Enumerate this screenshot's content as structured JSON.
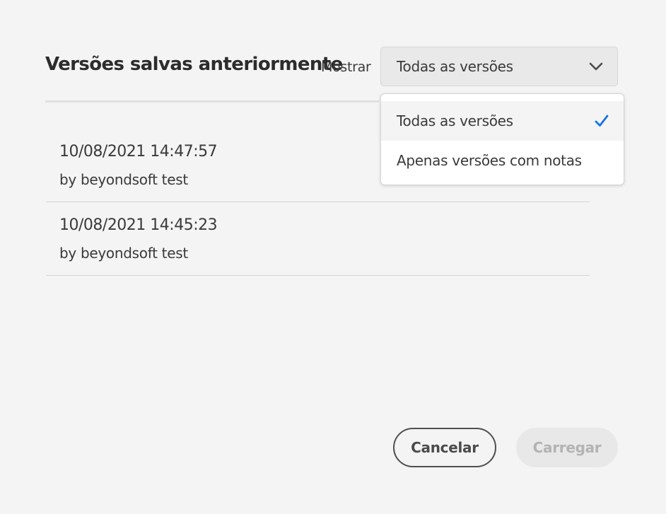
{
  "dialog": {
    "title": "Versões salvas anteriormente",
    "show_label": "Mostrar",
    "picker": {
      "selected": "Todas as versões",
      "icon": "chevron-down-icon"
    },
    "menu": {
      "items": [
        {
          "label": "Todas as versões",
          "selected": true,
          "icon": "checkmark-icon"
        },
        {
          "label": "Apenas versões com notas",
          "selected": false
        }
      ]
    },
    "versions": [
      {
        "datetime": "10/08/2021 14:47:57",
        "author": "by beyondsoft test"
      },
      {
        "datetime": "10/08/2021 14:45:23",
        "author": "by beyondsoft test"
      }
    ],
    "buttons": {
      "cancel": "Cancelar",
      "load": "Carregar"
    },
    "colors": {
      "accent": "#1473e6",
      "background": "#f4f4f4",
      "disabled_text": "#b3b3b3"
    }
  }
}
